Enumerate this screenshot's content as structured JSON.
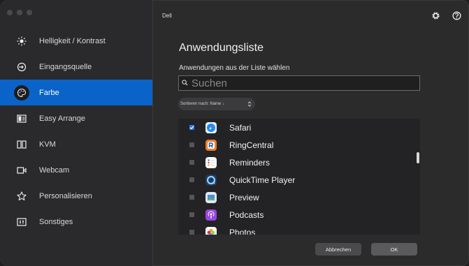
{
  "app": {
    "brand": "Dell"
  },
  "sidebar": {
    "items": [
      {
        "label": "Helligkeit / Kontrast",
        "icon": "sun-icon",
        "active": false
      },
      {
        "label": "Eingangsquelle",
        "icon": "input-source-icon",
        "active": false
      },
      {
        "label": "Farbe",
        "icon": "palette-icon",
        "active": true
      },
      {
        "label": "Easy Arrange",
        "icon": "layout-icon",
        "active": false
      },
      {
        "label": "KVM",
        "icon": "kvm-icon",
        "active": false
      },
      {
        "label": "Webcam",
        "icon": "webcam-icon",
        "active": false
      },
      {
        "label": "Personalisieren",
        "icon": "star-icon",
        "active": false
      },
      {
        "label": "Sonstiges",
        "icon": "settings-box-icon",
        "active": false
      }
    ]
  },
  "main": {
    "title": "Anwendungsliste",
    "subtitle": "Anwendungen aus der Liste wählen",
    "search_placeholder": "Suchen",
    "sort_label": "Sortieren nach: Name ↓",
    "apps": [
      {
        "name": "Safari",
        "checked": true,
        "icon": "safari-icon",
        "color": "#1a8cff"
      },
      {
        "name": "RingCentral",
        "checked": false,
        "icon": "ringcentral-icon",
        "color": "#f07c2a"
      },
      {
        "name": "Reminders",
        "checked": false,
        "icon": "reminders-icon",
        "color": "#ffffff"
      },
      {
        "name": "QuickTime Player",
        "checked": false,
        "icon": "quicktime-icon",
        "color": "#2a6fb8"
      },
      {
        "name": "Preview",
        "checked": false,
        "icon": "preview-icon",
        "color": "#4a8fd6"
      },
      {
        "name": "Podcasts",
        "checked": false,
        "icon": "podcasts-icon",
        "color": "#9b45e0"
      },
      {
        "name": "Photos",
        "checked": false,
        "icon": "photos-icon",
        "color": "#f5a623"
      }
    ],
    "cancel_label": "Abbrechen",
    "ok_label": "OK"
  },
  "colors": {
    "accent": "#0a63c9",
    "checkbox_checked": "#2e7be6"
  }
}
